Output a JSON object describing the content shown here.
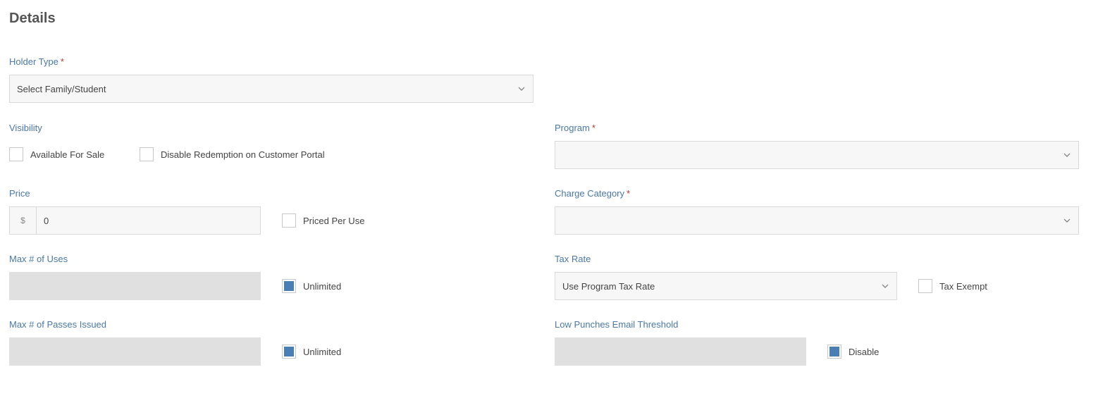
{
  "section_title": "Details",
  "holder_type": {
    "label": "Holder Type",
    "required_mark": "*",
    "value": "Select Family/Student"
  },
  "visibility": {
    "label": "Visibility",
    "available_for_sale": {
      "label": "Available For Sale",
      "checked": false
    },
    "disable_redemption": {
      "label": "Disable Redemption on Customer Portal",
      "checked": false
    }
  },
  "program": {
    "label": "Program",
    "required_mark": "*",
    "value": ""
  },
  "price": {
    "label": "Price",
    "currency_symbol": "$",
    "value": "0",
    "priced_per_use": {
      "label": "Priced Per Use",
      "checked": false
    }
  },
  "charge_category": {
    "label": "Charge Category",
    "required_mark": "*",
    "value": ""
  },
  "max_uses": {
    "label": "Max # of Uses",
    "unlimited": {
      "label": "Unlimited",
      "checked": true
    }
  },
  "tax_rate": {
    "label": "Tax Rate",
    "value": "Use Program Tax Rate",
    "tax_exempt": {
      "label": "Tax Exempt",
      "checked": false
    }
  },
  "max_passes": {
    "label": "Max # of Passes Issued",
    "unlimited": {
      "label": "Unlimited",
      "checked": true
    }
  },
  "low_punches": {
    "label": "Low Punches Email Threshold",
    "disable": {
      "label": "Disable",
      "checked": true
    }
  },
  "colors": {
    "label": "#4a78a8",
    "accent": "#4a7fb5",
    "required": "#c0392b"
  }
}
